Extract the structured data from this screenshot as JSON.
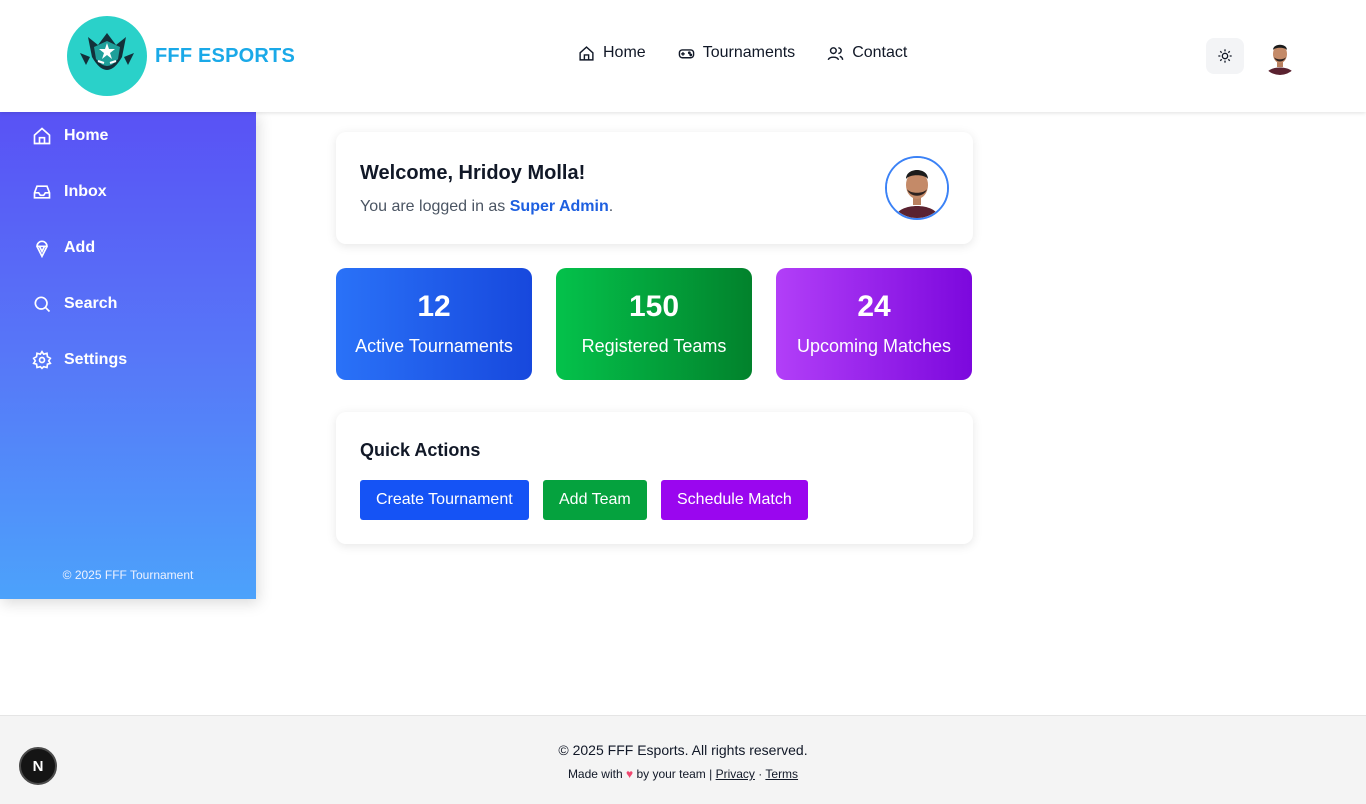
{
  "header": {
    "brand": "FFF ESPORTS",
    "logo_icon": "esports-mascot-logo",
    "nav": [
      {
        "label": "Home",
        "icon": "home-icon"
      },
      {
        "label": "Tournaments",
        "icon": "gamepad-icon"
      },
      {
        "label": "Contact",
        "icon": "users-icon"
      }
    ],
    "theme_icon": "sun-icon",
    "avatar_icon": "user-avatar"
  },
  "sidebar": {
    "items": [
      {
        "label": "Home",
        "icon": "home-icon"
      },
      {
        "label": "Inbox",
        "icon": "inbox-icon"
      },
      {
        "label": "Add",
        "icon": "ice-cream-icon"
      },
      {
        "label": "Search",
        "icon": "search-icon"
      },
      {
        "label": "Settings",
        "icon": "gear-icon"
      }
    ],
    "footer": "© 2025 FFF Tournament"
  },
  "welcome": {
    "title": "Welcome, Hridoy Molla!",
    "prefix": "You are logged in as ",
    "role": "Super Admin",
    "suffix": "."
  },
  "stats": [
    {
      "value": "12",
      "label": "Active Tournaments",
      "color": "#1f5ee9"
    },
    {
      "value": "150",
      "label": "Registered Teams",
      "color": "#03a23c"
    },
    {
      "value": "24",
      "label": "Upcoming Matches",
      "color": "#9a22ec"
    }
  ],
  "quick_actions": {
    "title": "Quick Actions",
    "buttons": [
      {
        "label": "Create Tournament",
        "color": "#1553f5"
      },
      {
        "label": "Add Team",
        "color": "#05a23e"
      },
      {
        "label": "Schedule Match",
        "color": "#9a06ef"
      }
    ]
  },
  "footer": {
    "copyright": "© 2025 FFF Esports. All rights reserved.",
    "made_with": "Made with",
    "heart": "♥",
    "by_team": " by your team | ",
    "privacy": "Privacy",
    "sep": " · ",
    "terms": "Terms"
  },
  "dev_badge": "N"
}
